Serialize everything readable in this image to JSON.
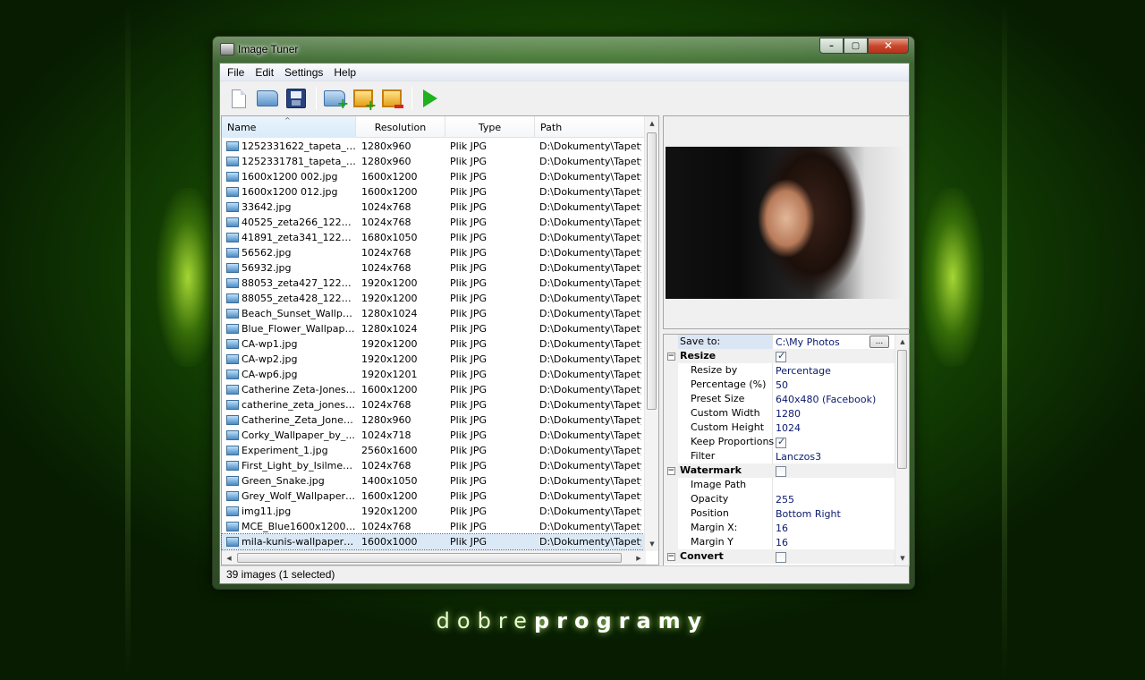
{
  "window": {
    "title": "Image Tuner",
    "controls": {
      "minimize": "–",
      "maximize": "▢",
      "close": "✕"
    }
  },
  "menu": [
    "File",
    "Edit",
    "Settings",
    "Help"
  ],
  "toolbar": [
    "new-icon",
    "open-folder-icon",
    "save-icon",
    "add-folder-icon",
    "add-images-icon",
    "remove-images-icon",
    "run-icon"
  ],
  "list": {
    "columns": {
      "name": "Name",
      "resolution": "Resolution",
      "type": "Type",
      "path": "Path"
    },
    "rows": [
      {
        "name": "1252331622_tapeta_zi...",
        "resolution": "1280x960",
        "type": "Plik JPG",
        "path": "D:\\Dokumenty\\Tapety\\"
      },
      {
        "name": "1252331781_tapeta_zi...",
        "resolution": "1280x960",
        "type": "Plik JPG",
        "path": "D:\\Dokumenty\\Tapety\\"
      },
      {
        "name": "1600x1200 002.jpg",
        "resolution": "1600x1200",
        "type": "Plik JPG",
        "path": "D:\\Dokumenty\\Tapety\\"
      },
      {
        "name": "1600x1200 012.jpg",
        "resolution": "1600x1200",
        "type": "Plik JPG",
        "path": "D:\\Dokumenty\\Tapety\\"
      },
      {
        "name": "33642.jpg",
        "resolution": "1024x768",
        "type": "Plik JPG",
        "path": "D:\\Dokumenty\\Tapety\\"
      },
      {
        "name": "40525_zeta266_122_4...",
        "resolution": "1024x768",
        "type": "Plik JPG",
        "path": "D:\\Dokumenty\\Tapety\\"
      },
      {
        "name": "41891_zeta341_122_6...",
        "resolution": "1680x1050",
        "type": "Plik JPG",
        "path": "D:\\Dokumenty\\Tapety\\"
      },
      {
        "name": "56562.jpg",
        "resolution": "1024x768",
        "type": "Plik JPG",
        "path": "D:\\Dokumenty\\Tapety\\"
      },
      {
        "name": "56932.jpg",
        "resolution": "1024x768",
        "type": "Plik JPG",
        "path": "D:\\Dokumenty\\Tapety\\"
      },
      {
        "name": "88053_zeta427_122_5...",
        "resolution": "1920x1200",
        "type": "Plik JPG",
        "path": "D:\\Dokumenty\\Tapety\\"
      },
      {
        "name": "88055_zeta428_122_2...",
        "resolution": "1920x1200",
        "type": "Plik JPG",
        "path": "D:\\Dokumenty\\Tapety\\"
      },
      {
        "name": "Beach_Sunset_Wallpap...",
        "resolution": "1280x1024",
        "type": "Plik JPG",
        "path": "D:\\Dokumenty\\Tapety\\"
      },
      {
        "name": "Blue_Flower_Wallpaper...",
        "resolution": "1280x1024",
        "type": "Plik JPG",
        "path": "D:\\Dokumenty\\Tapety\\"
      },
      {
        "name": "CA-wp1.jpg",
        "resolution": "1920x1200",
        "type": "Plik JPG",
        "path": "D:\\Dokumenty\\Tapety\\"
      },
      {
        "name": "CA-wp2.jpg",
        "resolution": "1920x1200",
        "type": "Plik JPG",
        "path": "D:\\Dokumenty\\Tapety\\"
      },
      {
        "name": "CA-wp6.jpg",
        "resolution": "1920x1201",
        "type": "Plik JPG",
        "path": "D:\\Dokumenty\\Tapety\\"
      },
      {
        "name": "Catherine Zeta-Jones_...",
        "resolution": "1600x1200",
        "type": "Plik JPG",
        "path": "D:\\Dokumenty\\Tapety\\"
      },
      {
        "name": "catherine_zeta_jones_...",
        "resolution": "1024x768",
        "type": "Plik JPG",
        "path": "D:\\Dokumenty\\Tapety\\"
      },
      {
        "name": "Catherine_Zeta_Jones...",
        "resolution": "1280x960",
        "type": "Plik JPG",
        "path": "D:\\Dokumenty\\Tapety\\"
      },
      {
        "name": "Corky_Wallpaper_by_...",
        "resolution": "1024x718",
        "type": "Plik JPG",
        "path": "D:\\Dokumenty\\Tapety\\"
      },
      {
        "name": "Experiment_1.jpg",
        "resolution": "2560x1600",
        "type": "Plik JPG",
        "path": "D:\\Dokumenty\\Tapety\\"
      },
      {
        "name": "First_Light_by_Isilmetri...",
        "resolution": "1024x768",
        "type": "Plik JPG",
        "path": "D:\\Dokumenty\\Tapety\\"
      },
      {
        "name": "Green_Snake.jpg",
        "resolution": "1400x1050",
        "type": "Plik JPG",
        "path": "D:\\Dokumenty\\Tapety\\"
      },
      {
        "name": "Grey_Wolf_Wallpaper_...",
        "resolution": "1600x1200",
        "type": "Plik JPG",
        "path": "D:\\Dokumenty\\Tapety\\"
      },
      {
        "name": "img11.jpg",
        "resolution": "1920x1200",
        "type": "Plik JPG",
        "path": "D:\\Dokumenty\\Tapety\\"
      },
      {
        "name": "MCE_Blue1600x1200.jpg",
        "resolution": "1024x768",
        "type": "Plik JPG",
        "path": "D:\\Dokumenty\\Tapety\\"
      },
      {
        "name": "mila-kunis-wallpapers_...",
        "resolution": "1600x1000",
        "type": "Plik JPG",
        "path": "D:\\Dokumenty\\Tapety\\",
        "selected": true
      }
    ]
  },
  "properties": {
    "save_to": {
      "label": "Save to:",
      "value": "C:\\My Photos",
      "button": "..."
    },
    "resize": {
      "label": "Resize",
      "checked": true,
      "items": [
        {
          "label": "Resize by",
          "value": "Percentage"
        },
        {
          "label": "Percentage (%)",
          "value": "50"
        },
        {
          "label": "Preset Size",
          "value": "640x480 (Facebook)"
        },
        {
          "label": "Custom Width",
          "value": "1280"
        },
        {
          "label": "Custom Height",
          "value": "1024"
        },
        {
          "label": "Keep Proportions",
          "value": "",
          "checkbox": true
        },
        {
          "label": "Filter",
          "value": "Lanczos3"
        }
      ]
    },
    "watermark": {
      "label": "Watermark",
      "checked": false,
      "items": [
        {
          "label": "Image Path",
          "value": ""
        },
        {
          "label": "Opacity",
          "value": "255"
        },
        {
          "label": "Position",
          "value": "Bottom Right"
        },
        {
          "label": "Margin X:",
          "value": "16"
        },
        {
          "label": "Margin Y",
          "value": "16"
        }
      ]
    },
    "convert": {
      "label": "Convert",
      "checked": false
    }
  },
  "status": "39 images (1 selected)",
  "brand": {
    "light": "dobre",
    "bold": "programy"
  }
}
